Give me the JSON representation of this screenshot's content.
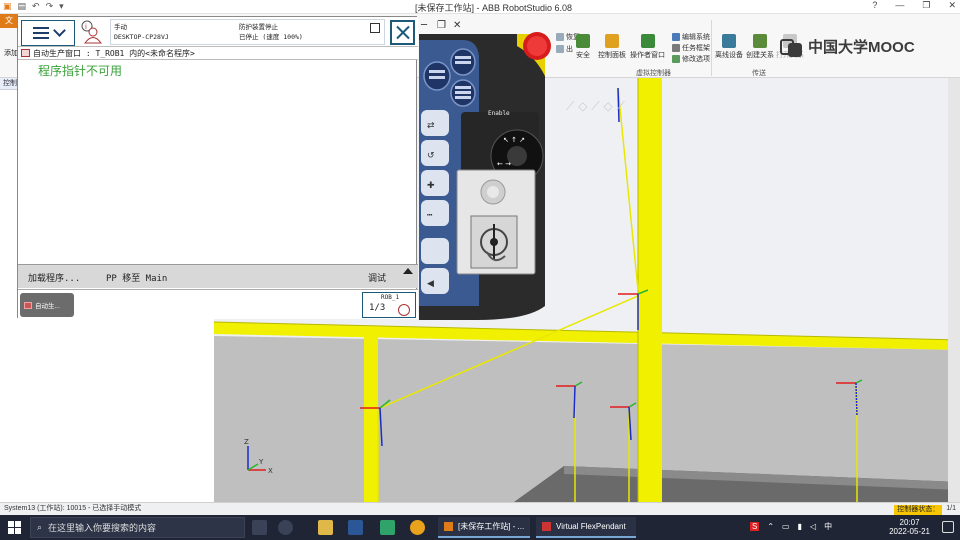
{
  "window": {
    "title": "[未保存工作站] - ABB RobotStudio 6.08",
    "controls": [
      "?",
      "—",
      "❐",
      "✕"
    ]
  },
  "ribbon": {
    "file_tab": "文",
    "left_cut": "添加",
    "items": {
      "safety": "安全",
      "control_panel": "控制面板",
      "operator_window": "操作者窗口",
      "edit_system": "编辑系统",
      "task_frame": "任务框架",
      "modify_options": "修改选项",
      "offline_device": "离线设备",
      "create_relation": "创建关系",
      "open_relation": "打开关系",
      "restore": "恢复",
      "input_output": "出"
    },
    "groups": {
      "virtual_controller": "虚拟控制器",
      "transfer": "传送"
    }
  },
  "leftdock": {
    "tab": "控制"
  },
  "flexpendant": {
    "mode": "手动",
    "system": "DESKTOP-CP28VJ",
    "safety_state": "防护装置停止",
    "run_state": "已停止 (速度 100%)",
    "window_title": "自动生产窗口 : T_ROB1 内的<未命名程序>",
    "message": "程序指针不可用",
    "cmd_load": "加载程序...",
    "cmd_pp": "PP 移至 Main",
    "cmd_debug": "调试",
    "task_label": "自动生...",
    "rob_name": "ROB_1",
    "rob_fraction": "1/3",
    "enable_label": "Enable"
  },
  "mooc": {
    "text": "中国大学MOOC"
  },
  "viewport": {
    "axes": {
      "x": "X",
      "y": "Y",
      "z": "Z"
    }
  },
  "statusbar": {
    "left": "System13 (工作站): 10015 - 已选择手动模式",
    "controller_status_label": "控制器状态：",
    "controller_status_value": "1/1"
  },
  "taskbar": {
    "search_placeholder": "在这里输入你要搜索的内容",
    "app1": "[未保存工作站] - ...",
    "app2": "Virtual FlexPendant",
    "time": "20:07",
    "date": "2022-05-21",
    "ime": "中",
    "ime_icon": "S"
  },
  "colors": {
    "accent_orange": "#e07b19",
    "fp_green": "#3aa23a",
    "ctrl_status": "#f7c600",
    "taskbar": "#1f2535",
    "pillar_yellow": "#f0f000"
  }
}
